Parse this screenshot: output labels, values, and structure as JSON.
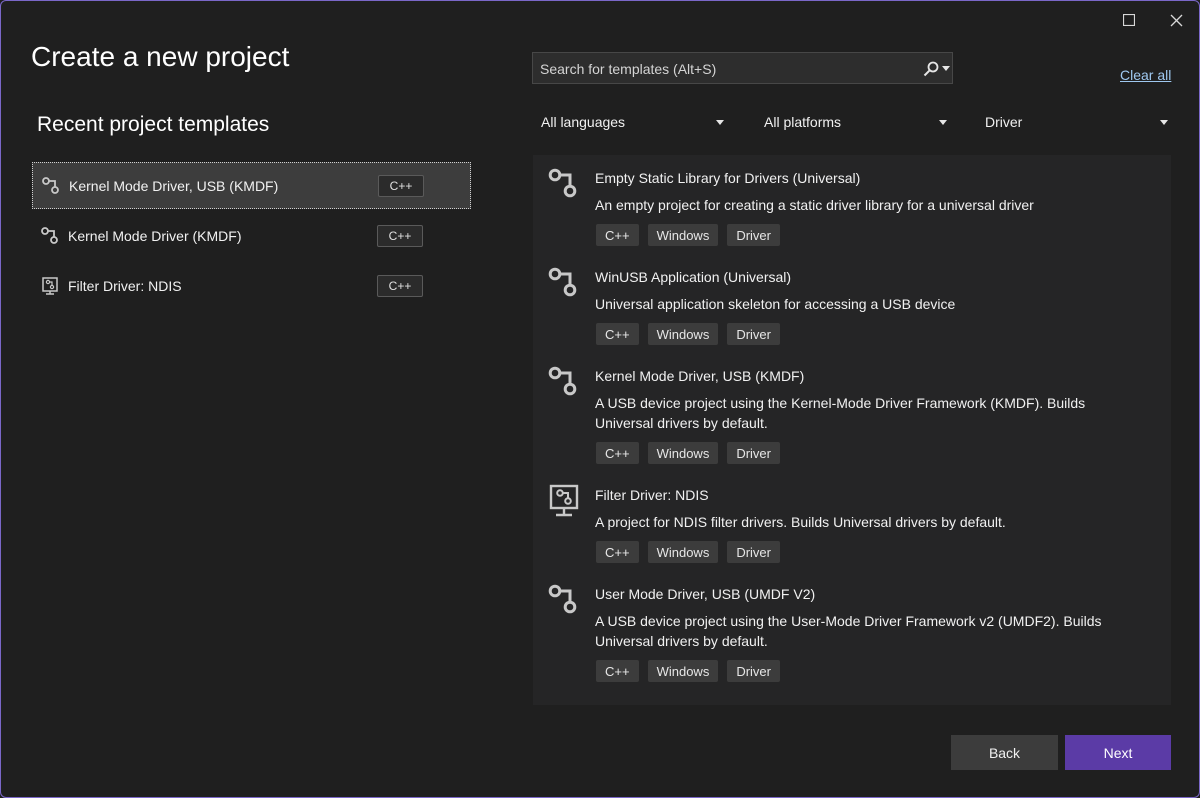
{
  "window": {
    "maximize_icon": "maximize-icon",
    "close_icon": "close-icon",
    "accent": "#7a67c8"
  },
  "header": {
    "title": "Create a new project"
  },
  "recent": {
    "title": "Recent project templates",
    "items": [
      {
        "label": "Kernel Mode Driver, USB (KMDF)",
        "tag": "C++",
        "icon": "usb-driver-icon",
        "selected": true
      },
      {
        "label": "Kernel Mode Driver (KMDF)",
        "tag": "C++",
        "icon": "usb-driver-icon",
        "selected": false
      },
      {
        "label": "Filter Driver: NDIS",
        "tag": "C++",
        "icon": "network-driver-icon",
        "selected": false
      }
    ]
  },
  "search": {
    "placeholder": "Search for templates (Alt+S)",
    "icon": "search-icon"
  },
  "clear_all": "Clear all",
  "filters": {
    "language": "All languages",
    "platform": "All platforms",
    "project_type": "Driver"
  },
  "templates": [
    {
      "title": "Empty Static Library for Drivers (Universal)",
      "description": "An empty project for creating a static driver library for a universal driver",
      "tags": [
        "C++",
        "Windows",
        "Driver"
      ],
      "icon": "usb-driver-icon"
    },
    {
      "title": "WinUSB Application (Universal)",
      "description": "Universal application skeleton for accessing a USB device",
      "tags": [
        "C++",
        "Windows",
        "Driver"
      ],
      "icon": "usb-driver-icon"
    },
    {
      "title": "Kernel Mode Driver, USB (KMDF)",
      "description": "A USB device project using the Kernel-Mode Driver Framework (KMDF). Builds Universal drivers by default.",
      "tags": [
        "C++",
        "Windows",
        "Driver"
      ],
      "icon": "usb-driver-icon"
    },
    {
      "title": "Filter Driver: NDIS",
      "description": "A project for NDIS filter drivers. Builds Universal drivers by default.",
      "tags": [
        "C++",
        "Windows",
        "Driver"
      ],
      "icon": "network-driver-icon"
    },
    {
      "title": "User Mode Driver, USB (UMDF V2)",
      "description": "A USB device project using the User-Mode Driver Framework v2 (UMDF2). Builds Universal drivers by default.",
      "tags": [
        "C++",
        "Windows",
        "Driver"
      ],
      "icon": "usb-driver-icon"
    }
  ],
  "buttons": {
    "back": "Back",
    "next": "Next",
    "next_color": "#5b3ba6"
  }
}
